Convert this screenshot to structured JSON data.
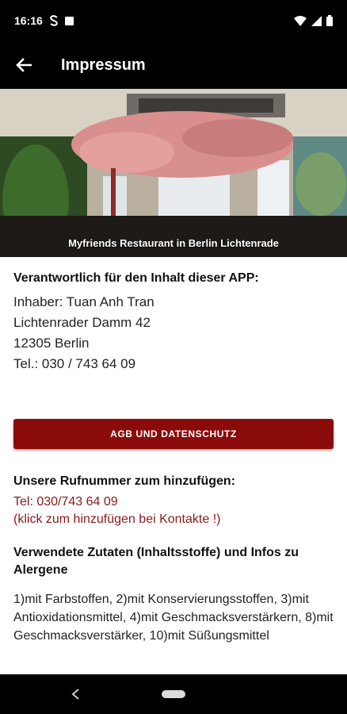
{
  "status_bar": {
    "time": "16:16"
  },
  "app_bar": {
    "title": "Impressum"
  },
  "hero": {
    "caption": "Myfriends Restaurant in Berlin Lichtenrade"
  },
  "responsible": {
    "heading": "Verantwortlich für den Inhalt dieser APP:",
    "lines": [
      "Inhaber: Tuan Anh Tran",
      "Lichtenrader Damm 42",
      "12305 Berlin",
      "Tel.: 030 / 743 64 09"
    ]
  },
  "agb_button": {
    "label": "AGB UND DATENSCHUTZ"
  },
  "phone": {
    "heading": "Unsere Rufnummer zum hinzufügen:",
    "number": "Tel: 030/743 64 09",
    "hint": "(klick zum hinzufügen bei Kontakte !)"
  },
  "ingredients": {
    "heading": "Verwendete Zutaten (Inhaltsstoffe) und Infos zu Alergene",
    "text": "1)mit Farbstoffen, 2)mit Konservierungsstoffen, 3)mit Antioxidationsmittel, 4)mit Geschmacksverstärkern, 8)mit Geschmacksverstärker, 10)mit Süßungsmittel"
  },
  "colors": {
    "accent": "#8b0b0b",
    "link": "#8b1a1a",
    "bars": "#000000"
  }
}
